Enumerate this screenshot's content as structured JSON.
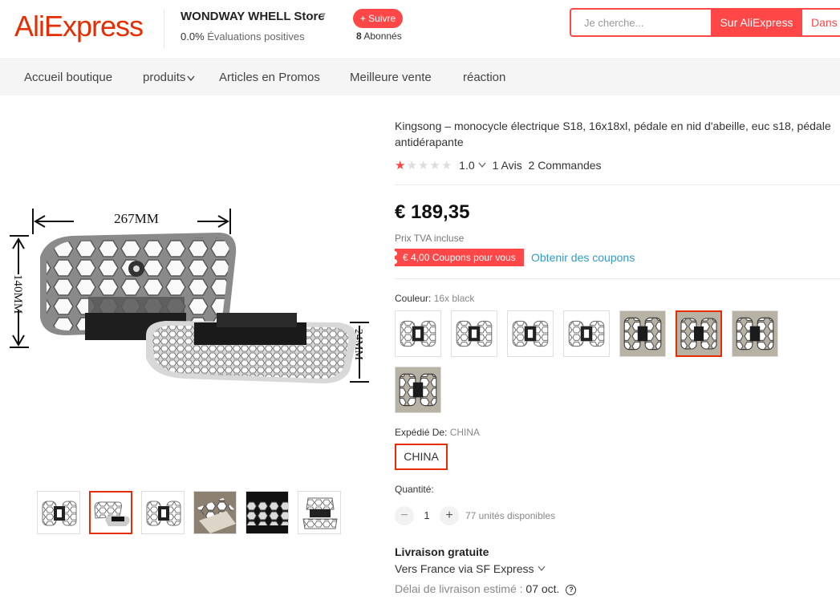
{
  "header": {
    "logo": "AliExpress",
    "store_name": "WONDWAY WHELL Store",
    "store_rating_value": "0.0%",
    "store_rating_label": "Évaluations positives",
    "follow_label": "+ Suivre",
    "followers_count": "8",
    "followers_label": "Abonnés",
    "search_placeholder": "Je cherche...",
    "search_button": "Sur AliExpress",
    "search_store_button": "Dans c"
  },
  "nav": {
    "items": [
      "Accueil boutique",
      "produits",
      "Articles en Promos",
      "Meilleure vente",
      "réaction"
    ]
  },
  "gallery": {
    "dim_width": "267MM",
    "dim_height": "140MM",
    "dim_thickness": "24MM",
    "active_thumb_index": 1
  },
  "product": {
    "title": "Kingsong – monocycle électrique S18, 16x18xl, pédale en nid d'abeille, euc s18, pédale antidérapante",
    "rating_value": "1.0",
    "rating_stars": 1,
    "reviews": "1 Avis",
    "orders": "2 Commandes",
    "price": "€ 189,35",
    "vat_note": "Prix TVA incluse",
    "coupon": "€ 4,00 Coupons pour vous",
    "get_coupons": "Obtenir des coupons",
    "color_label": "Couleur:",
    "color_value": "16x black",
    "selected_color_index": 5,
    "ship_from_label": "Expédié De:",
    "ship_from_value": "CHINA",
    "ship_from_option": "CHINA",
    "quantity_label": "Quantité:",
    "quantity": "1",
    "available": "77 unités disponibles",
    "free_shipping": "Livraison gratuite",
    "ship_via": "Vers France via SF Express",
    "delivery_label": "Délai de livraison estimé :",
    "delivery_date": "07 oct."
  },
  "colors": {
    "accent": "#ff4747",
    "brand": "#e62e04",
    "link": "#2e9cc3"
  }
}
